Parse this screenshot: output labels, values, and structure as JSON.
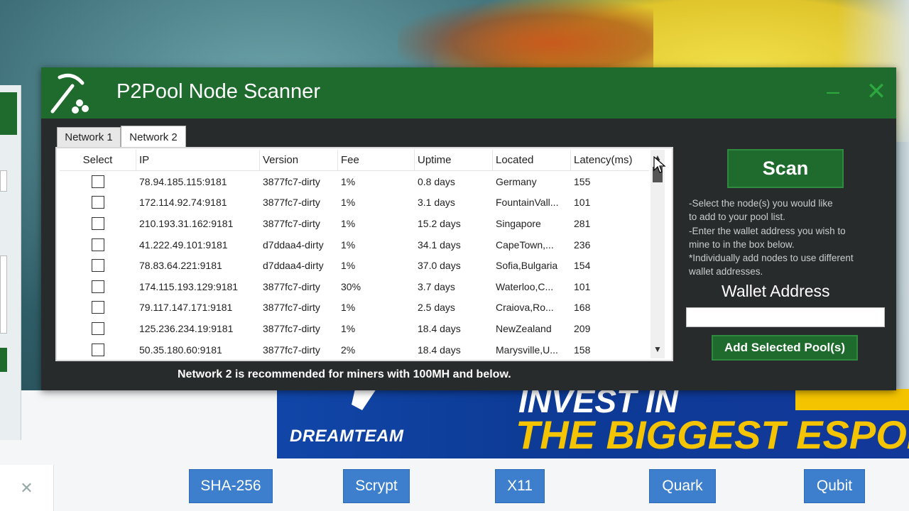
{
  "window": {
    "title": "P2Pool Node Scanner",
    "minimize_icon": "minimize-icon",
    "close_icon": "close-icon"
  },
  "tabs": [
    {
      "label": "Network 1",
      "active": false
    },
    {
      "label": "Network 2",
      "active": true
    }
  ],
  "grid": {
    "columns": [
      "Select",
      "IP",
      "Version",
      "Fee",
      "Uptime",
      "Located",
      "Latency(ms)"
    ],
    "rows": [
      {
        "ip": "78.94.185.115:9181",
        "version": "3877fc7-dirty",
        "fee": "1%",
        "uptime": "0.8 days",
        "located": "Germany",
        "latency": "155"
      },
      {
        "ip": "172.114.92.74:9181",
        "version": "3877fc7-dirty",
        "fee": "1%",
        "uptime": "3.1 days",
        "located": "FountainVall...",
        "latency": "101"
      },
      {
        "ip": "210.193.31.162:9181",
        "version": "3877fc7-dirty",
        "fee": "1%",
        "uptime": "15.2 days",
        "located": "Singapore",
        "latency": "281"
      },
      {
        "ip": "41.222.49.101:9181",
        "version": "d7ddaa4-dirty",
        "fee": "1%",
        "uptime": "34.1 days",
        "located": "CapeTown,...",
        "latency": "236"
      },
      {
        "ip": "78.83.64.221:9181",
        "version": "d7ddaa4-dirty",
        "fee": "1%",
        "uptime": "37.0 days",
        "located": "Sofia,Bulgaria",
        "latency": "154"
      },
      {
        "ip": "174.115.193.129:9181",
        "version": "3877fc7-dirty",
        "fee": "30%",
        "uptime": "3.7 days",
        "located": "Waterloo,C...",
        "latency": "101"
      },
      {
        "ip": "79.117.147.171:9181",
        "version": "3877fc7-dirty",
        "fee": "1%",
        "uptime": "2.5 days",
        "located": "Craiova,Ro...",
        "latency": "168"
      },
      {
        "ip": "125.236.234.19:9181",
        "version": "3877fc7-dirty",
        "fee": "1%",
        "uptime": "18.4 days",
        "located": "NewZealand",
        "latency": "209"
      },
      {
        "ip": "50.35.180.60:9181",
        "version": "3877fc7-dirty",
        "fee": "2%",
        "uptime": "18.4 days",
        "located": "Marysville,U...",
        "latency": "158"
      }
    ]
  },
  "footer_note": "Network 2 is recommended for miners with 100MH and below.",
  "side_panel": {
    "scan_label": "Scan",
    "help_lines": [
      "-Select the node(s) you would like",
      "to add to your pool list.",
      "-Enter the wallet address you wish to",
      "mine to in the box below.",
      "*Individually add nodes to use different",
      "wallet addresses."
    ],
    "wallet_label": "Wallet Address",
    "wallet_value": "",
    "add_label": "Add Selected Pool(s)"
  },
  "ad": {
    "brand": "DREAMTEAM",
    "line1": "INVEST IN",
    "line2": "THE BIGGEST ESPORTS"
  },
  "algo_buttons": [
    "SHA-256",
    "Scrypt",
    "X11",
    "Quark",
    "Qubit"
  ],
  "colors": {
    "titlebar": "#1f6b2e",
    "window_bg": "#282b2b",
    "algo_button": "#3d7fcc",
    "ad_bg": "#1146a8",
    "ad_accent": "#f4c400"
  }
}
